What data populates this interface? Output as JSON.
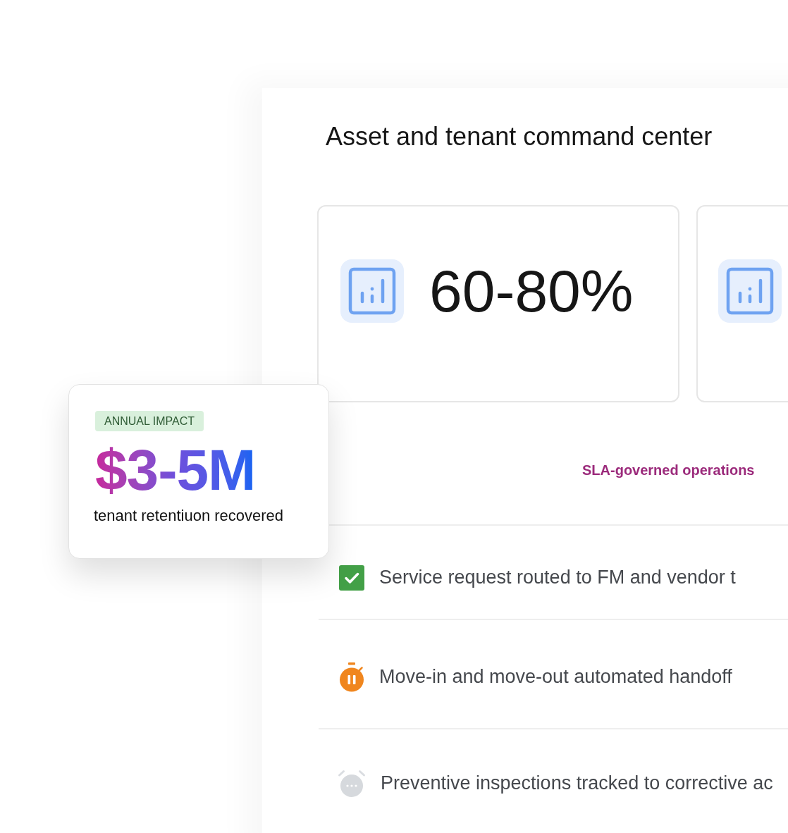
{
  "panel": {
    "title": "Asset and tenant command center"
  },
  "stat_cards": [
    {
      "kind": "full",
      "value": "60-80%"
    },
    {
      "kind": "cut"
    }
  ],
  "impact_card": {
    "badge": "ANNUAL IMPACT",
    "value": "$3-5M",
    "caption": "tenant retentiuon recovered"
  },
  "section_label": "SLA-governed operations",
  "checklist": [
    {
      "kind": "done",
      "text": "Service request routed to FM and vendor t"
    },
    {
      "kind": "paused",
      "text": "Move-in and move-out automated handoff"
    },
    {
      "kind": "pending",
      "text": "Preventive inspections tracked to corrective ac"
    }
  ]
}
